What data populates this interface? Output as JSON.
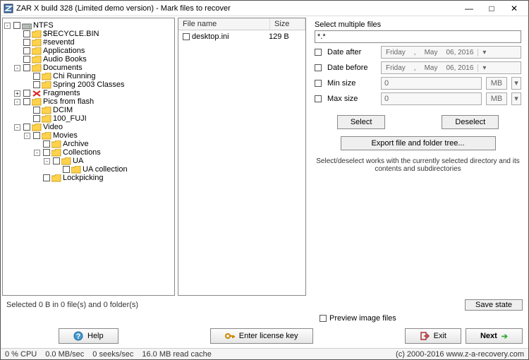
{
  "window": {
    "title": "ZAR X build 328 (Limited demo version) - Mark files to recover",
    "min": "—",
    "max": "□",
    "close": "✕"
  },
  "tree": [
    {
      "l": "NTFS",
      "d": 0,
      "e": "-",
      "i": "drv"
    },
    {
      "l": "$RECYCLE.BIN",
      "d": 1,
      "e": "",
      "i": "fld"
    },
    {
      "l": "#seventd",
      "d": 1,
      "e": "",
      "i": "fld"
    },
    {
      "l": "Applications",
      "d": 1,
      "e": "",
      "i": "fld"
    },
    {
      "l": "Audio Books",
      "d": 1,
      "e": "",
      "i": "fld"
    },
    {
      "l": "Documents",
      "d": 1,
      "e": "-",
      "i": "fld"
    },
    {
      "l": "Chi Running",
      "d": 2,
      "e": "",
      "i": "fld"
    },
    {
      "l": "Spring 2003 Classes",
      "d": 2,
      "e": "",
      "i": "fld"
    },
    {
      "l": "Fragments",
      "d": 1,
      "e": "+",
      "i": "frag"
    },
    {
      "l": "Pics from flash",
      "d": 1,
      "e": "-",
      "i": "fld"
    },
    {
      "l": "DCIM",
      "d": 2,
      "e": "",
      "i": "fld"
    },
    {
      "l": "100_FUJI",
      "d": 2,
      "e": "",
      "i": "fld"
    },
    {
      "l": "Video",
      "d": 1,
      "e": "-",
      "i": "fld"
    },
    {
      "l": "Movies",
      "d": 2,
      "e": "-",
      "i": "fld"
    },
    {
      "l": "Archive",
      "d": 3,
      "e": "",
      "i": "fld"
    },
    {
      "l": "Collections",
      "d": 3,
      "e": "-",
      "i": "fld"
    },
    {
      "l": "UA",
      "d": 4,
      "e": "-",
      "i": "fld"
    },
    {
      "l": "UA collection",
      "d": 5,
      "e": "",
      "i": "fld"
    },
    {
      "l": "Lockpicking",
      "d": 3,
      "e": "",
      "i": "fld"
    }
  ],
  "file_list": {
    "headers": {
      "name": "File name",
      "size": "Size"
    },
    "rows": [
      {
        "name": "desktop.ini",
        "size": "129 B"
      }
    ]
  },
  "filters": {
    "title": "Select multiple files",
    "mask": "*.*",
    "date_after": "Date after",
    "date_before": "Date before",
    "min_size": "Min size",
    "max_size": "Max size",
    "day": "Friday",
    "comma": ",",
    "month": "May",
    "date": "06, 2016",
    "size_val": "0",
    "size_unit": "MB",
    "select": "Select",
    "deselect": "Deselect",
    "export": "Export file and folder tree...",
    "hint": "Select/deselect works with the currently selected directory and its contents and subdirectories"
  },
  "status": {
    "text": "Selected 0 B in 0 file(s) and 0 folder(s)",
    "save": "Save state"
  },
  "preview": "Preview image files",
  "buttons": {
    "help": "Help",
    "license": "Enter license key",
    "exit": "Exit",
    "next": "Next"
  },
  "footer": {
    "cpu": "0 % CPU",
    "mbs": "0.0 MB/sec",
    "seeks": "0 seeks/sec",
    "cache": "16.0 MB read cache",
    "copy": "(c) 2000-2016 www.z-a-recovery.com"
  }
}
